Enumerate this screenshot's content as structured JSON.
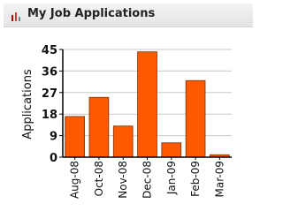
{
  "widget": {
    "title": "My Job Applications",
    "icon": "bar-chart-icon"
  },
  "colors": {
    "bar_fill": "#ff5a00",
    "bar_stroke": "#7a2e00",
    "grid": "#c8c8c8",
    "axis": "#000000",
    "icon_bars": [
      "#b40000",
      "#d43c3c",
      "#7f7f7f"
    ]
  },
  "chart_data": {
    "type": "bar",
    "title": "",
    "xlabel": "",
    "ylabel": "Applications",
    "categories": [
      "Aug-08",
      "Oct-08",
      "Nov-08",
      "Dec-08",
      "Jan-09",
      "Feb-09",
      "Mar-09"
    ],
    "values": [
      17,
      25,
      13,
      44,
      6,
      32,
      1
    ],
    "ylim": [
      0,
      45
    ],
    "yticks": [
      0,
      9,
      18,
      27,
      36,
      45
    ],
    "grid": true,
    "legend": "none"
  }
}
